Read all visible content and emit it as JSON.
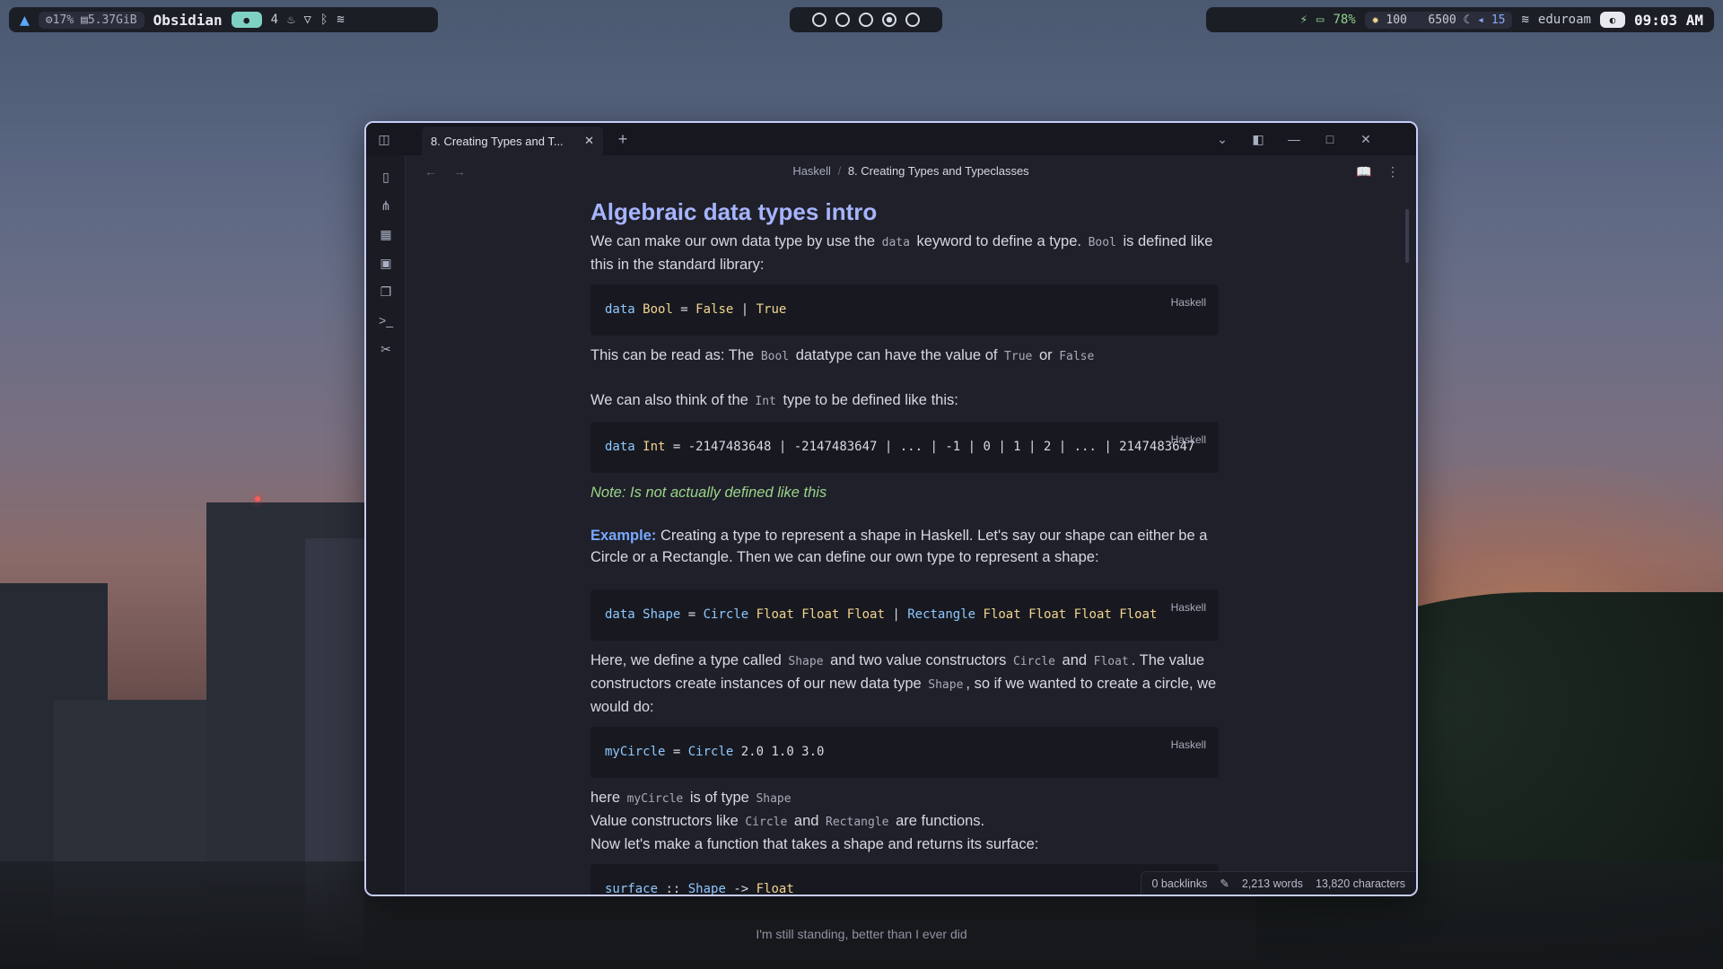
{
  "topbar": {
    "left": {
      "cpu": "17%",
      "mem": "5.37GiB",
      "app_name": "Obsidian",
      "workspace_count": "4"
    },
    "workspaces_total": 5,
    "workspace_active_index": 3,
    "right": {
      "battery": "78%",
      "brightness": "100",
      "temperature": "6500",
      "volume": "15",
      "network": "eduroam",
      "time": "09:03 AM"
    }
  },
  "window": {
    "tab_title": "8. Creating Types and T...",
    "breadcrumb_parent": "Haskell",
    "breadcrumb_sep": "/",
    "breadcrumb_current": "8. Creating Types and Typeclasses"
  },
  "note": {
    "heading": "Algebraic data types intro",
    "p1_a": "We can make our own data type by use the ",
    "p1_code": "data",
    "p1_b": " keyword to define a type. ",
    "p1_code2": "Bool",
    "p1_c": " is defined like this in the standard library:",
    "code_lang": "Haskell",
    "p2_a": "This can be read as: The ",
    "p2_code": "Bool",
    "p2_b": " datatype can have the value of ",
    "p2_code2": "True",
    "p2_c": " or ",
    "p2_code3": "False",
    "p3_a": "We can also think of the ",
    "p3_code": "Int",
    "p3_b": " type to be defined like this:",
    "note_text": "Note: Is not actually defined like this",
    "example_label": "Example:",
    "example_text": " Creating a type to represent a shape in Haskell. Let's say our shape can either be a Circle or a Rectangle. Then we can define our own type to represent a shape:",
    "p5_a": "Here, we define a type called ",
    "p5_code": "Shape",
    "p5_b": " and two value constructors ",
    "p5_code2": "Circle",
    "p5_c": " and ",
    "p5_code3": "Float",
    "p5_d": ". The value constructors create instances of our new data type ",
    "p5_code4": "Shape",
    "p5_e": ", so if we wanted to create a circle, we would do:",
    "p6_a": "here ",
    "p6_code": "myCircle",
    "p6_b": " is of type ",
    "p6_code2": "Shape",
    "p7_a": "Value constructors like ",
    "p7_code": "Circle",
    "p7_b": " and ",
    "p7_code2": "Rectangle",
    "p7_c": " are functions.",
    "p8": "Now let's make a function that takes a shape and returns its surface:"
  },
  "status": {
    "backlinks": "0 backlinks",
    "words": "2,213 words",
    "characters": "13,820 characters"
  },
  "lyrics": "I'm still standing, better than I ever did"
}
